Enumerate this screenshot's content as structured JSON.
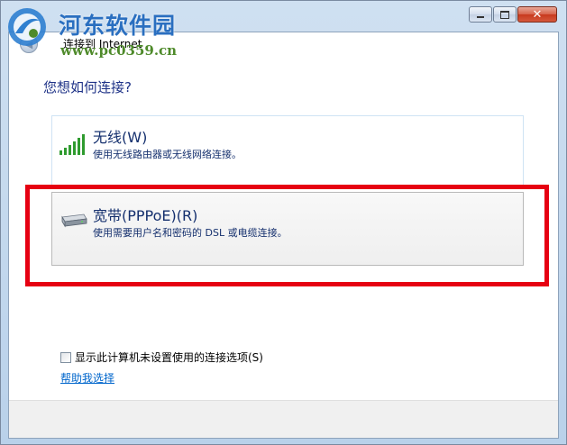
{
  "watermark": {
    "site_name": "河东软件园",
    "url": "www.pc0359.cn"
  },
  "window": {
    "nav_title": "连接到 Internet",
    "buttons": {
      "minimize_icon": "minimize-icon",
      "maximize_icon": "maximize-icon",
      "close_icon": "close-icon",
      "close_glyph": "✕"
    }
  },
  "main": {
    "question": "您想如何连接?",
    "options": [
      {
        "label": "无线(W)",
        "description": "使用无线路由器或无线网络连接。",
        "icon": "wireless-signal-icon"
      },
      {
        "label": "宽带(PPPoE)(R)",
        "description": "使用需要用户名和密码的 DSL 或电缆连接。",
        "icon": "broadband-modem-icon"
      }
    ],
    "checkbox_label": "显示此计算机未设置使用的连接选项(S)",
    "help_link": "帮助我选择"
  },
  "colors": {
    "highlight": "#e60012",
    "option_text": "#15306e",
    "link": "#0066cc",
    "watermark_blue": "#2a6fc0",
    "watermark_green": "#4e8a2a"
  }
}
